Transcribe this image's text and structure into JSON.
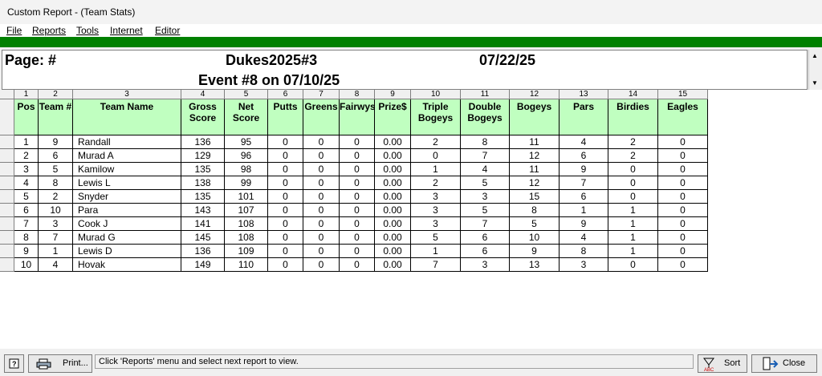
{
  "window": {
    "title": "Custom Report - (Team Stats)"
  },
  "menu": [
    "File",
    "Reports",
    "Tools",
    "Internet",
    "Editor"
  ],
  "header": {
    "page": "Page: #",
    "league": "Dukes2025#3",
    "date": "07/22/25",
    "event": "Event #8 on 07/10/25"
  },
  "columns": [
    {
      "num": "1",
      "label": "Pos"
    },
    {
      "num": "2",
      "label": "Team #"
    },
    {
      "num": "3",
      "label": "Team Name"
    },
    {
      "num": "4",
      "label": "Gross Score"
    },
    {
      "num": "5",
      "label": "Net Score"
    },
    {
      "num": "6",
      "label": "Putts"
    },
    {
      "num": "7",
      "label": "Greens"
    },
    {
      "num": "8",
      "label": "Fairwys"
    },
    {
      "num": "9",
      "label": "Prize$"
    },
    {
      "num": "10",
      "label": "Triple Bogeys"
    },
    {
      "num": "11",
      "label": "Double Bogeys"
    },
    {
      "num": "12",
      "label": "Bogeys"
    },
    {
      "num": "13",
      "label": "Pars"
    },
    {
      "num": "14",
      "label": "Birdies"
    },
    {
      "num": "15",
      "label": "Eagles"
    }
  ],
  "rows": [
    [
      "1",
      "9",
      "Randall",
      "136",
      "95",
      "0",
      "0",
      "0",
      "0.00",
      "2",
      "8",
      "11",
      "4",
      "2",
      "0"
    ],
    [
      "2",
      "6",
      "Murad A",
      "129",
      "96",
      "0",
      "0",
      "0",
      "0.00",
      "0",
      "7",
      "12",
      "6",
      "2",
      "0"
    ],
    [
      "3",
      "5",
      "Kamilow",
      "135",
      "98",
      "0",
      "0",
      "0",
      "0.00",
      "1",
      "4",
      "11",
      "9",
      "0",
      "0"
    ],
    [
      "4",
      "8",
      "Lewis L",
      "138",
      "99",
      "0",
      "0",
      "0",
      "0.00",
      "2",
      "5",
      "12",
      "7",
      "0",
      "0"
    ],
    [
      "5",
      "2",
      "Snyder",
      "135",
      "101",
      "0",
      "0",
      "0",
      "0.00",
      "3",
      "3",
      "15",
      "6",
      "0",
      "0"
    ],
    [
      "6",
      "10",
      "Para",
      "143",
      "107",
      "0",
      "0",
      "0",
      "0.00",
      "3",
      "5",
      "8",
      "1",
      "1",
      "0"
    ],
    [
      "7",
      "3",
      "Cook J",
      "141",
      "108",
      "0",
      "0",
      "0",
      "0.00",
      "3",
      "7",
      "5",
      "9",
      "1",
      "0"
    ],
    [
      "8",
      "7",
      "Murad G",
      "145",
      "108",
      "0",
      "0",
      "0",
      "0.00",
      "5",
      "6",
      "10",
      "4",
      "1",
      "0"
    ],
    [
      "9",
      "1",
      "Lewis D",
      "136",
      "109",
      "0",
      "0",
      "0",
      "0.00",
      "1",
      "6",
      "9",
      "8",
      "1",
      "0"
    ],
    [
      "10",
      "4",
      "Hovak",
      "149",
      "110",
      "0",
      "0",
      "0",
      "0.00",
      "7",
      "3",
      "13",
      "3",
      "0",
      "0"
    ]
  ],
  "status": {
    "print_label": "Print...",
    "message": "Click 'Reports' menu and select next report to view.",
    "sort_label": "Sort",
    "close_label": "Close"
  },
  "colors": {
    "accent_green": "#008000",
    "header_green": "#c0ffc0"
  }
}
